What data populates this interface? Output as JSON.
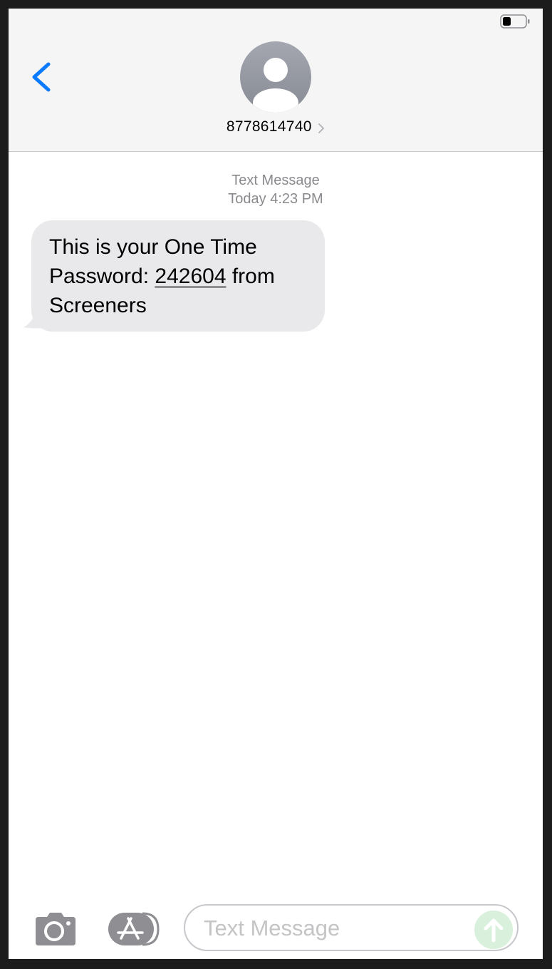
{
  "header": {
    "contact_name": "8778614740",
    "battery_level": 0.35
  },
  "conversation": {
    "service_label": "Text Message",
    "date_day": "Today",
    "date_time": " 4:23 PM",
    "message": {
      "text_before": "This is your One Time Password: ",
      "otp_code": "242604",
      "text_after": " from Screeners"
    }
  },
  "toolbar": {
    "input_placeholder": "Text Message"
  },
  "colors": {
    "accent": "#0a7aff",
    "bubble": "#e9e9eb",
    "send_disabled": "#d8f0dc",
    "avatar": "#8e9199"
  },
  "icons": {
    "back": "chevron-left-icon",
    "contact_detail": "chevron-right-icon",
    "camera": "camera-icon",
    "apps": "app-store-icon",
    "send": "arrow-up-icon",
    "avatar": "person-icon",
    "battery": "battery-icon"
  }
}
